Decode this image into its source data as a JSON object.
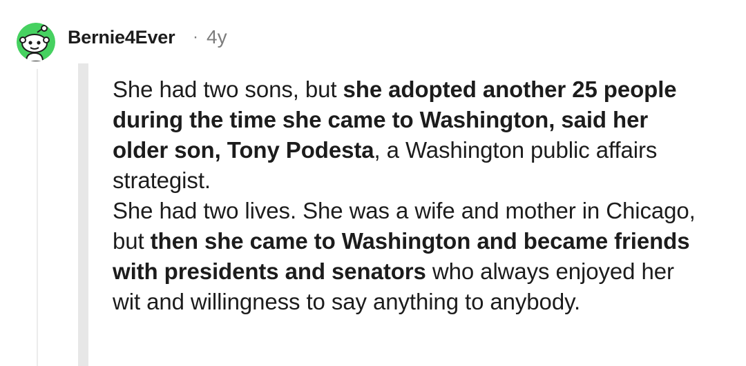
{
  "comment": {
    "username": "Bernie4Ever",
    "separator": "·",
    "age": "4y",
    "avatar_icon": "snoo-avatar-icon",
    "quote": {
      "paragraph1": {
        "t1": "She had two sons, but ",
        "b1": "she adopted another 25 people during the time she came to Washington, said her older son, Tony Podesta",
        "t2": ", a Washington public affairs strategist."
      },
      "paragraph2": {
        "t1": "She had two lives. She was a wife and mother in Chicago, but ",
        "b1": "then she came to Washington and became friends with presidents and senators",
        "t2": " who always enjoyed her wit and willingness to say anything to anybody."
      }
    }
  },
  "colors": {
    "text": "#1c1c1c",
    "meta": "#7c7c7c",
    "quote_bar": "#e7e7e7",
    "thread_line": "#ececec",
    "avatar_green": "#46d160"
  }
}
